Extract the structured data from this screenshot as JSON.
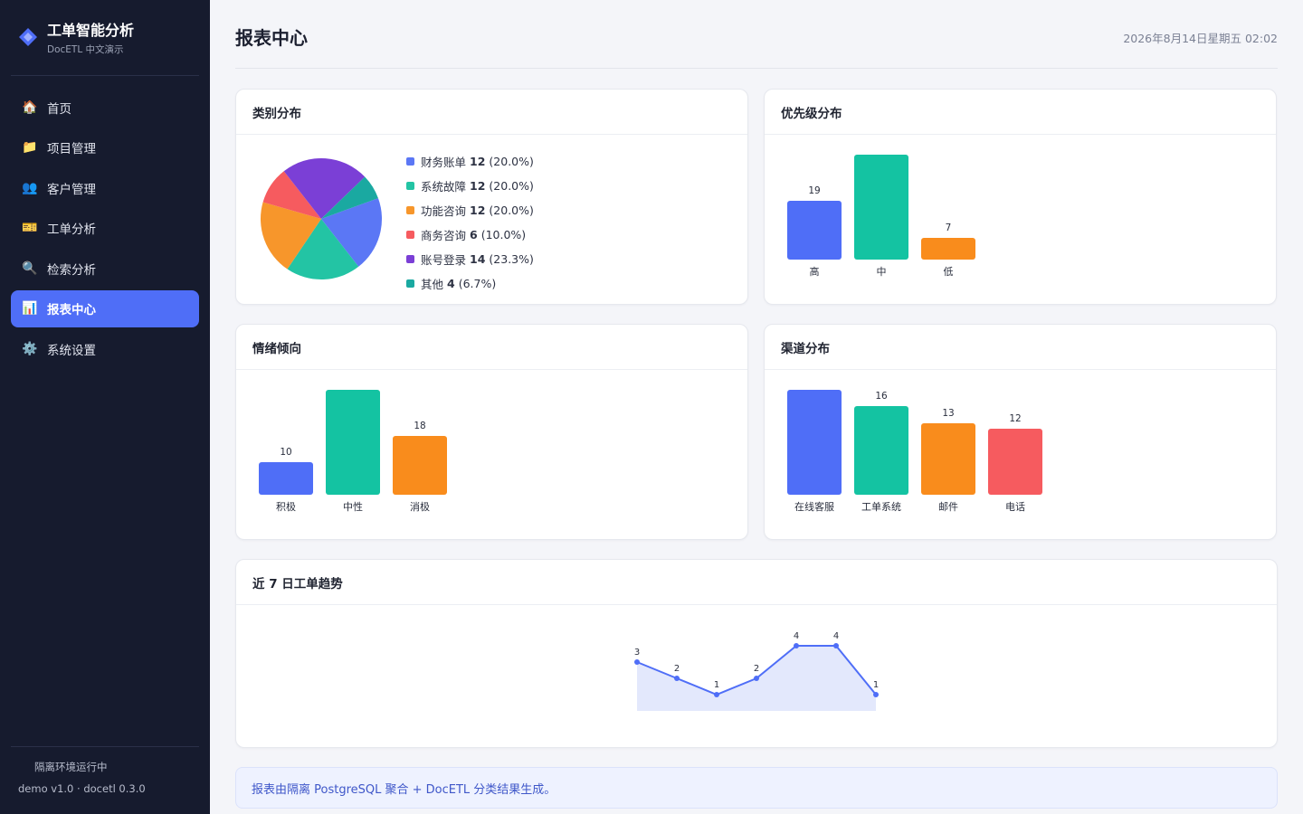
{
  "sidebar": {
    "title": "工单智能分析",
    "subtitle": "DocETL 中文演示",
    "nav": [
      {
        "label": "首页",
        "icon": "house-icon",
        "glyph": "🏠",
        "active": false
      },
      {
        "label": "项目管理",
        "icon": "folder-icon",
        "glyph": "📁",
        "active": false
      },
      {
        "label": "客户管理",
        "icon": "users-icon",
        "glyph": "👥",
        "active": false
      },
      {
        "label": "工单分析",
        "icon": "ticket-icon",
        "glyph": "🎫",
        "active": false
      },
      {
        "label": "检索分析",
        "icon": "magnifier-icon",
        "glyph": "🔍",
        "active": false
      },
      {
        "label": "报表中心",
        "icon": "bar-chart-icon",
        "glyph": "📊",
        "active": true
      },
      {
        "label": "系统设置",
        "icon": "gear-icon",
        "glyph": "⚙️",
        "active": false
      }
    ],
    "status": "隔离环境运行中",
    "version": "demo v1.0 · docetl 0.3.0"
  },
  "header": {
    "title": "报表中心",
    "date": "2026年8月14日星期五 02:02"
  },
  "cards": {
    "category": "类别分布",
    "priority": "优先级分布",
    "sentiment": "情绪倾向",
    "channel": "渠道分布",
    "trend": "近 7 日工单趋势"
  },
  "note": "报表由隔离 PostgreSQL 聚合 + DocETL 分类结果生成。",
  "colors": {
    "accent": "#4f6ef7",
    "blue": "#5b77f5",
    "teal": "#14c3a2",
    "orange": "#f98c1c",
    "red": "#f65b5f",
    "purple": "#7b3fd6",
    "cyan": "#12a89c"
  },
  "chart_data": [
    {
      "type": "pie",
      "id": "category",
      "categories": [
        "财务账单",
        "系统故障",
        "功能咨询",
        "商务咨询",
        "账号登录",
        "其他"
      ],
      "values": [
        12,
        12,
        12,
        6,
        14,
        4
      ],
      "percent_labels": [
        "(20.0%)",
        "(20.0%)",
        "(20.0%)",
        "(10.0%)",
        "(23.3%)",
        "(6.7%)"
      ],
      "colors": [
        "#5b77f5",
        "#23c4a4",
        "#f7962b",
        "#f65b5f",
        "#7b3fd6",
        "#1aa9a1"
      ],
      "legend_position": "right"
    },
    {
      "type": "bar",
      "id": "priority",
      "categories": [
        "高",
        "中",
        "低"
      ],
      "values": [
        19,
        34,
        7
      ],
      "value_labels": [
        "19",
        "",
        "7"
      ],
      "colors": [
        "#4f6ef7",
        "#14c3a2",
        "#f98c1c"
      ]
    },
    {
      "type": "bar",
      "id": "sentiment",
      "categories": [
        "积极",
        "中性",
        "消极"
      ],
      "values": [
        10,
        32,
        18
      ],
      "value_labels": [
        "10",
        "",
        "18"
      ],
      "colors": [
        "#4f6ef7",
        "#14c3a2",
        "#f98c1c"
      ]
    },
    {
      "type": "bar",
      "id": "channel",
      "categories": [
        "在线客服",
        "工单系统",
        "邮件",
        "电话"
      ],
      "values": [
        19,
        16,
        13,
        12
      ],
      "value_labels": [
        "",
        "16",
        "13",
        "12"
      ],
      "colors": [
        "#4f6ef7",
        "#14c3a2",
        "#f98c1c",
        "#f65b5f"
      ]
    },
    {
      "type": "area",
      "id": "trend",
      "values": [
        3,
        2,
        1,
        2,
        4,
        4,
        1
      ],
      "value_labels": [
        "3",
        "2",
        "1",
        "2",
        "4",
        "4",
        "1"
      ],
      "color": "#4f6ef7",
      "fill": "#e3e8fc"
    }
  ]
}
